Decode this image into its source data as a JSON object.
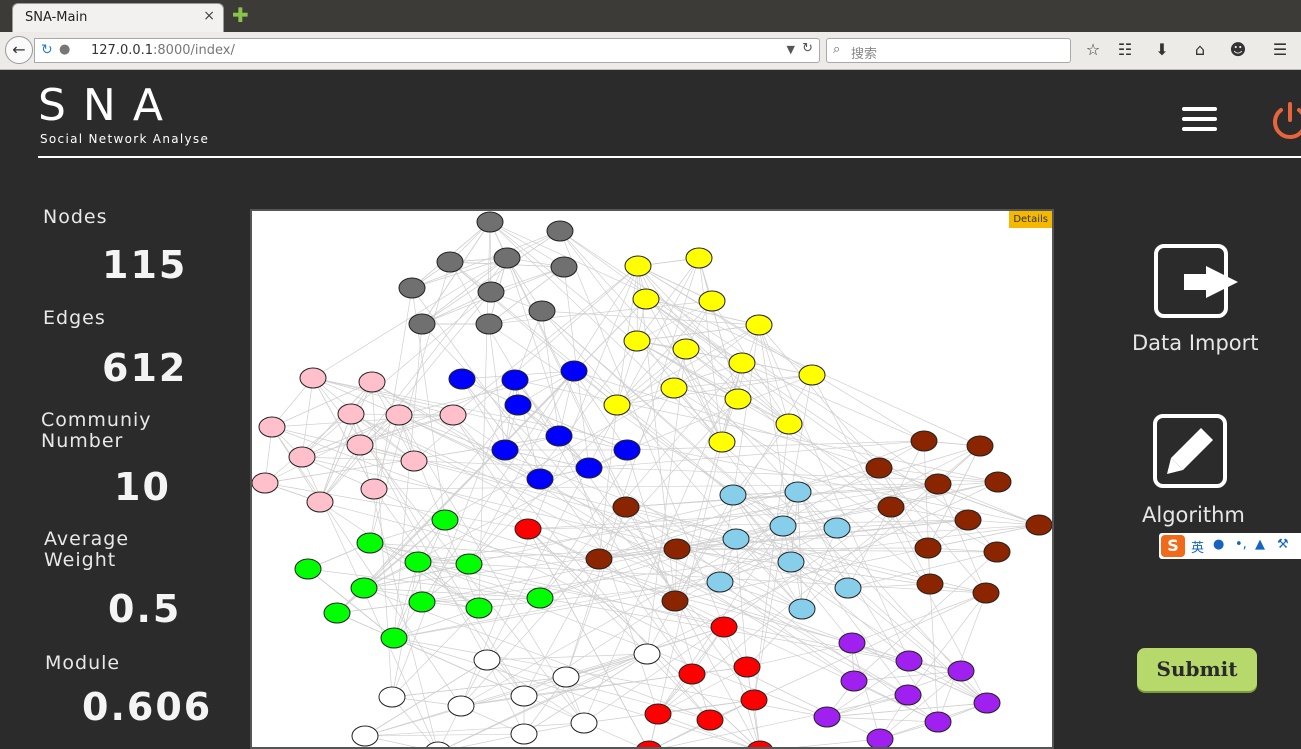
{
  "browser": {
    "tab_title": "SNA-Main",
    "tab_close": "×",
    "new_tab": "✚",
    "url_host": "127.0.0.1",
    "url_rest": ":8000/index/",
    "search_placeholder": "搜索"
  },
  "header": {
    "logo": "SNA",
    "subtitle": "Social Network Analyse"
  },
  "stats": {
    "nodes_label": "Nodes",
    "nodes_value": "115",
    "edges_label": "Edges",
    "edges_value": "612",
    "community_label_1": "Communiy",
    "community_label_2": "Number",
    "community_value": "10",
    "weight_label_1": "Average",
    "weight_label_2": "Weight",
    "weight_value": "0.5",
    "module_label": "Module",
    "module_value": "0.606"
  },
  "graph": {
    "details_label": "Details",
    "community_colors": [
      "#707070",
      "#ffff00",
      "#ffc0cb",
      "#0000ff",
      "#8b2500",
      "#87ceeb",
      "#00ff00",
      "#ff0000",
      "#ffffff",
      "#a020f0"
    ]
  },
  "sidebar": {
    "data_import_label": "Data Import",
    "algorithm_label": "Algorithm",
    "submit_label": "Submit"
  },
  "ime": {
    "logo": "S",
    "lang": "英"
  },
  "colors": {
    "background": "#2b2b2b",
    "accent_power": "#e8643c",
    "submit_bg": "#b7d86b",
    "details_bg": "#f5b800"
  }
}
